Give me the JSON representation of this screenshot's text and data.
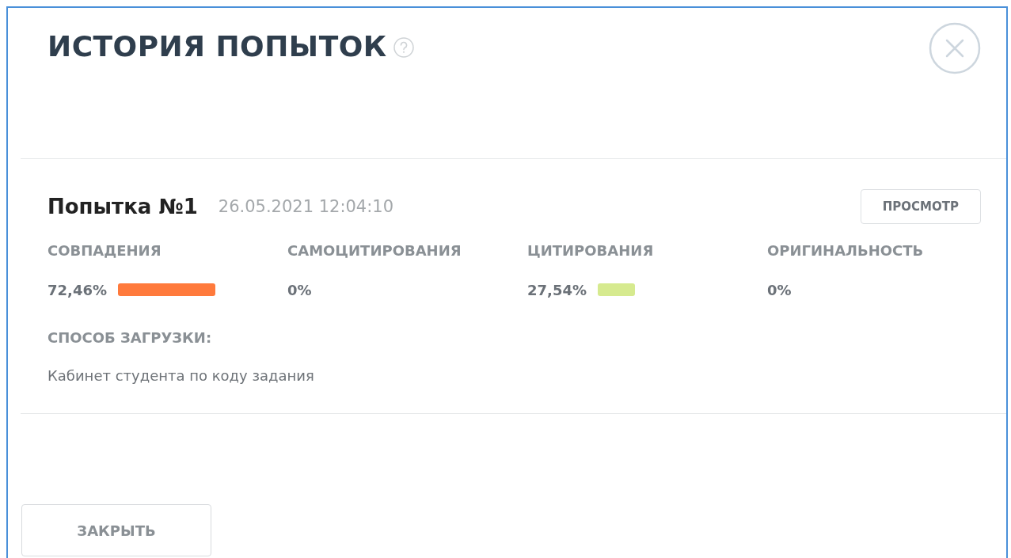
{
  "dialog": {
    "title": "ИСТОРИЯ ПОПЫТОК"
  },
  "attempts": [
    {
      "name": "Попытка №1",
      "datetime": "26.05.2021 12:04:10",
      "view_button": "ПРОСМОТР",
      "metrics": [
        {
          "label": "СОВПАДЕНИЯ",
          "value": "72,46%",
          "color": "#ff7a3c"
        },
        {
          "label": "САМОЦИТИРОВАНИЯ",
          "value": "0%"
        },
        {
          "label": "ЦИТИРОВАНИЯ",
          "value": "27,54%",
          "color": "#d6ea8f"
        },
        {
          "label": "ОРИГИНАЛЬНОСТЬ",
          "value": "0%"
        }
      ],
      "upload_label": "СПОСОБ ЗАГРУЗКИ:",
      "upload_method": "Кабинет студента по коду задания"
    }
  ],
  "close_button": "ЗАКРЫТЬ"
}
